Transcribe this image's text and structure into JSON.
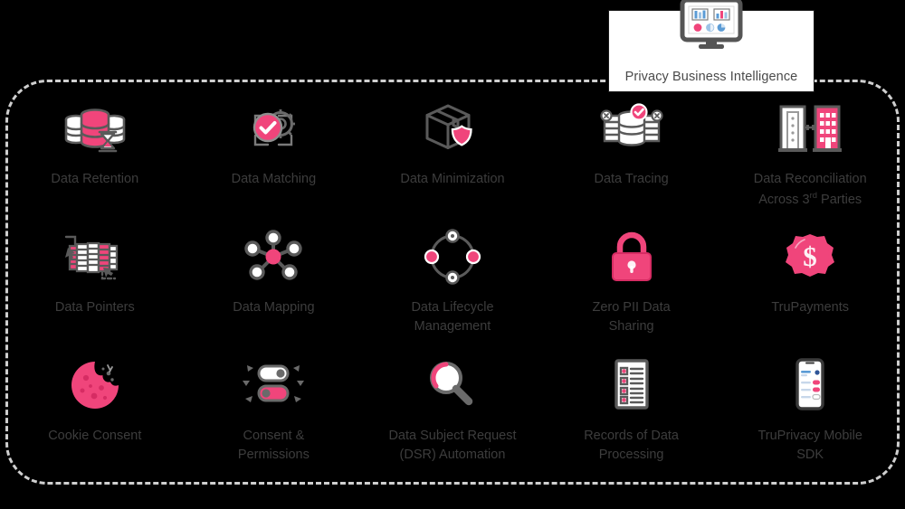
{
  "colors": {
    "background": "#000000",
    "accent_pink": "#F0457B",
    "accent_pink_dark": "#D62C63",
    "icon_gray": "#5a5a5a",
    "icon_gray_light": "#9b9b9b",
    "text_gray": "#3d3d3d",
    "dashed_border": "#CFCFCF",
    "card_background": "#FFFFFF",
    "chart_blue": "#5B9BD5",
    "chart_blue_light": "#9DC3E6"
  },
  "header_card": {
    "label": "Privacy Business Intelligence",
    "icon": "monitor-dashboard-icon"
  },
  "container": {
    "name": "privacy-capabilities-container",
    "border_style": "dashed"
  },
  "tiles": [
    {
      "id": "data-retention",
      "label": "Data Retention",
      "icon": "database-hourglass-icon"
    },
    {
      "id": "data-matching",
      "label": "Data Matching",
      "icon": "check-gear-match-icon"
    },
    {
      "id": "data-minimization",
      "label": "Data Minimization",
      "icon": "box-shield-icon"
    },
    {
      "id": "data-tracing",
      "label": "Data Tracing",
      "icon": "database-trace-check-icon"
    },
    {
      "id": "data-reconciliation",
      "label": "Data Reconciliation\nAcross 3rd Parties",
      "label_main": "Data Reconciliation",
      "label_sub_pre": "Across 3",
      "label_sup": "rd",
      "label_sub_post": " Parties",
      "icon": "two-buildings-icon"
    },
    {
      "id": "data-pointers",
      "label": "Data Pointers",
      "icon": "database-pointers-icon"
    },
    {
      "id": "data-mapping",
      "label": "Data Mapping",
      "icon": "network-nodes-icon"
    },
    {
      "id": "data-lifecycle-management",
      "label": "Data Lifecycle\nManagement",
      "icon": "lifecycle-ring-icon"
    },
    {
      "id": "zero-pii-data-sharing",
      "label": "Zero PII Data\nSharing",
      "icon": "padlock-icon"
    },
    {
      "id": "trupayments",
      "label": "TruPayments",
      "icon": "dollar-coin-icon"
    },
    {
      "id": "cookie-consent",
      "label": "Cookie Consent",
      "icon": "cookie-icon"
    },
    {
      "id": "consent-permissions",
      "label": "Consent &\nPermissions",
      "icon": "toggle-switches-icon"
    },
    {
      "id": "dsr-automation",
      "label": "Data Subject Request\n(DSR) Automation",
      "icon": "magnifier-icon"
    },
    {
      "id": "records-of-data-processing",
      "label": "Records of Data\nProcessing",
      "icon": "checklist-document-icon"
    },
    {
      "id": "truprivacy-mobile-sdk",
      "label": "TruPrivacy Mobile\nSDK",
      "icon": "mobile-phone-icon"
    }
  ]
}
